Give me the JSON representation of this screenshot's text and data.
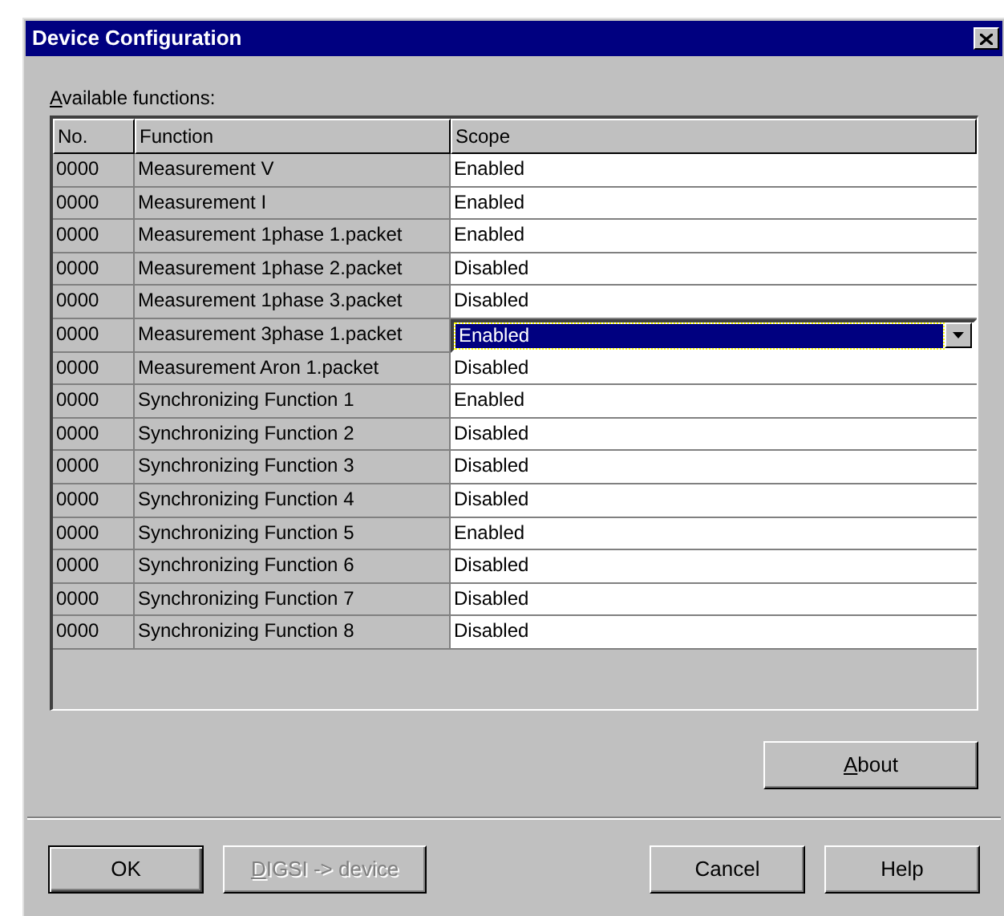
{
  "window": {
    "title": "Device Configuration"
  },
  "functions_label": {
    "text": "Available functions:",
    "mnemonic": true
  },
  "table": {
    "columns": [
      "No.",
      "Function",
      "Scope"
    ],
    "rows": [
      {
        "no": "0000",
        "function": "Measurement V",
        "scope": "Enabled",
        "selected": false
      },
      {
        "no": "0000",
        "function": "Measurement I",
        "scope": "Enabled",
        "selected": false
      },
      {
        "no": "0000",
        "function": "Measurement 1phase 1.packet",
        "scope": "Enabled",
        "selected": false
      },
      {
        "no": "0000",
        "function": "Measurement 1phase 2.packet",
        "scope": "Disabled",
        "selected": false
      },
      {
        "no": "0000",
        "function": "Measurement 1phase 3.packet",
        "scope": "Disabled",
        "selected": false
      },
      {
        "no": "0000",
        "function": "Measurement 3phase 1.packet",
        "scope": "Enabled",
        "selected": true
      },
      {
        "no": "0000",
        "function": "Measurement Aron 1.packet",
        "scope": "Disabled",
        "selected": false
      },
      {
        "no": "0000",
        "function": "Synchronizing Function 1",
        "scope": "Enabled",
        "selected": false
      },
      {
        "no": "0000",
        "function": "Synchronizing Function 2",
        "scope": "Disabled",
        "selected": false
      },
      {
        "no": "0000",
        "function": "Synchronizing Function 3",
        "scope": "Disabled",
        "selected": false
      },
      {
        "no": "0000",
        "function": "Synchronizing Function 4",
        "scope": "Disabled",
        "selected": false
      },
      {
        "no": "0000",
        "function": "Synchronizing Function 5",
        "scope": "Enabled",
        "selected": false
      },
      {
        "no": "0000",
        "function": "Synchronizing Function 6",
        "scope": "Disabled",
        "selected": false
      },
      {
        "no": "0000",
        "function": "Synchronizing Function 7",
        "scope": "Disabled",
        "selected": false
      },
      {
        "no": "0000",
        "function": "Synchronizing Function 8",
        "scope": "Disabled",
        "selected": false
      }
    ]
  },
  "about_button": {
    "label": "About",
    "mnemonic": true,
    "disabled": false,
    "default": false
  },
  "buttons": [
    {
      "label": "OK",
      "disabled": false,
      "default": true,
      "mnemonic": false
    },
    {
      "label": "DIGSI -> device",
      "disabled": true,
      "default": false,
      "mnemonic": true
    },
    {
      "label": "Cancel",
      "disabled": false,
      "default": false,
      "mnemonic": false
    },
    {
      "label": "Help",
      "disabled": false,
      "default": false,
      "mnemonic": false
    }
  ]
}
